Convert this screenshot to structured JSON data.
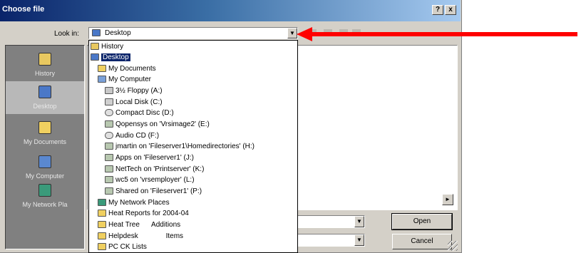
{
  "dialog": {
    "title": "Choose file",
    "help_label": "?",
    "close_label": "x",
    "look_in_label": "Look in:",
    "look_in_value": "Desktop"
  },
  "places": [
    {
      "label": "History",
      "icon": "history-icon"
    },
    {
      "label": "Desktop",
      "icon": "desktop-icon",
      "selected": true
    },
    {
      "label": "My Documents",
      "icon": "my-documents-icon"
    },
    {
      "label": "My Computer",
      "icon": "my-computer-icon"
    },
    {
      "label": "My Network Pla",
      "icon": "network-places-icon"
    }
  ],
  "buttons": {
    "open_label": "Open",
    "cancel_label": "Cancel"
  },
  "dropdown": {
    "items": [
      {
        "label": "History",
        "indent": 0,
        "icon": "history-icon"
      },
      {
        "label": "Desktop",
        "indent": 0,
        "icon": "desktop-icon",
        "selected": true
      },
      {
        "label": "My Documents",
        "indent": 1,
        "icon": "folder-icon"
      },
      {
        "label": "My Computer",
        "indent": 1,
        "icon": "computer-icon"
      },
      {
        "label": "3½ Floppy (A:)",
        "indent": 2,
        "icon": "floppy-icon"
      },
      {
        "label": "Local Disk (C:)",
        "indent": 2,
        "icon": "drive-icon"
      },
      {
        "label": "Compact Disc (D:)",
        "indent": 2,
        "icon": "cd-icon"
      },
      {
        "label": "Qopensys on 'Vrsimage2' (E:)",
        "indent": 2,
        "icon": "network-drive-icon"
      },
      {
        "label": "Audio CD (F:)",
        "indent": 2,
        "icon": "cd-icon"
      },
      {
        "label": "jmartin on 'Fileserver1\\Homedirectories' (H:)",
        "indent": 2,
        "icon": "network-drive-icon"
      },
      {
        "label": "Apps on 'Fileserver1' (J:)",
        "indent": 2,
        "icon": "network-drive-icon"
      },
      {
        "label": "NetTech on 'Printserver' (K:)",
        "indent": 2,
        "icon": "network-drive-icon"
      },
      {
        "label": "wc5 on 'vrsemployer' (L:)",
        "indent": 2,
        "icon": "network-drive-icon"
      },
      {
        "label": "Shared on 'Fileserver1' (P:)",
        "indent": 2,
        "icon": "network-drive-icon"
      },
      {
        "label": "My Network Places",
        "indent": 1,
        "icon": "network-places-icon"
      },
      {
        "label": "Heat Reports for 2004-04",
        "indent": 1,
        "icon": "folder-icon"
      },
      {
        "label": "Heat Tree      Additions",
        "indent": 1,
        "icon": "folder-icon"
      },
      {
        "label": "Helpdesk              Items",
        "indent": 1,
        "icon": "folder-icon"
      },
      {
        "label": "PC CK Lists",
        "indent": 1,
        "icon": "folder-icon"
      }
    ]
  },
  "colors": {
    "title_bar": "#0a246a",
    "selection": "#0a246a",
    "annotation_arrow": "#ff0000"
  }
}
